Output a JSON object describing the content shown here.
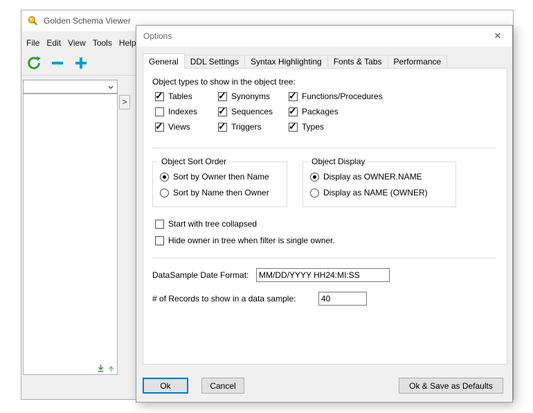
{
  "main_window": {
    "title": "Golden Schema Viewer",
    "menu": [
      {
        "label": "File"
      },
      {
        "label": "Edit"
      },
      {
        "label": "View"
      },
      {
        "label": "Tools"
      },
      {
        "label": "Help"
      }
    ]
  },
  "icons": {
    "close": "✕",
    "expand_right": ">"
  },
  "colors": {
    "focus_blue": "#0078d7",
    "toolbar_green": "#2e9e2e",
    "toolbar_teal": "#00a2c7",
    "titlebar_bg": "#ffffff",
    "window_bg": "#f0f0f0"
  },
  "dialog": {
    "title": "Options",
    "tabs": [
      {
        "label": "General",
        "selected": true
      },
      {
        "label": "DDL Settings",
        "selected": false
      },
      {
        "label": "Syntax Highlighting",
        "selected": false
      },
      {
        "label": "Fonts & Tabs",
        "selected": false
      },
      {
        "label": "Performance",
        "selected": false
      }
    ],
    "general": {
      "object_types_label": "Object types to show in the object tree:",
      "object_types": {
        "col1": [
          {
            "label": "Tables",
            "checked": true
          },
          {
            "label": "Indexes",
            "checked": false
          },
          {
            "label": "Views",
            "checked": true
          }
        ],
        "col2": [
          {
            "label": "Synonyms",
            "checked": true
          },
          {
            "label": "Sequences",
            "checked": true
          },
          {
            "label": "Triggers",
            "checked": true
          }
        ],
        "col3": [
          {
            "label": "Functions/Procedures",
            "checked": true
          },
          {
            "label": "Packages",
            "checked": true
          },
          {
            "label": "Types",
            "checked": true
          }
        ]
      },
      "sort_group": {
        "title": "Object Sort Order",
        "options": [
          {
            "label": "Sort by Owner then Name",
            "selected": true
          },
          {
            "label": "Sort by Name then Owner",
            "selected": false
          }
        ]
      },
      "display_group": {
        "title": "Object Display",
        "options": [
          {
            "label": "Display as OWNER.NAME",
            "selected": true
          },
          {
            "label": "Display as NAME (OWNER)",
            "selected": false
          }
        ]
      },
      "tree_options": [
        {
          "label": "Start with tree collapsed",
          "checked": false
        },
        {
          "label": "Hide owner in tree when filter is single owner.",
          "checked": false
        }
      ],
      "date_format": {
        "label": "DataSample Date Format:",
        "value": "MM/DD/YYYY HH24:MI:SS"
      },
      "records": {
        "label": "# of Records to show in a data sample:",
        "value": "40"
      }
    },
    "footer": {
      "ok": "Ok",
      "cancel": "Cancel",
      "save_defaults": "Ok & Save as Defaults"
    }
  }
}
